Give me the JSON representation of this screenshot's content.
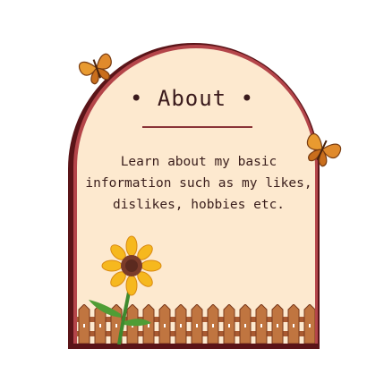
{
  "card": {
    "title": "• About •",
    "description": "Learn about my basic information such as my likes, dislikes, hobbies etc."
  },
  "colors": {
    "card_background": "#fde9cf",
    "frame_outer": "#5a1418",
    "frame_rim": "#b4454a",
    "title_text": "#3a1a1c",
    "fence": "#b7673a",
    "butterfly": "#e08a2c",
    "sunflower_petals": "#f6b81e"
  },
  "decorations": {
    "left_butterfly_icon": "butterfly-icon",
    "right_butterfly_icon": "butterfly-icon",
    "flower_icon": "sunflower-icon",
    "fence_icon": "picket-fence-icon"
  }
}
